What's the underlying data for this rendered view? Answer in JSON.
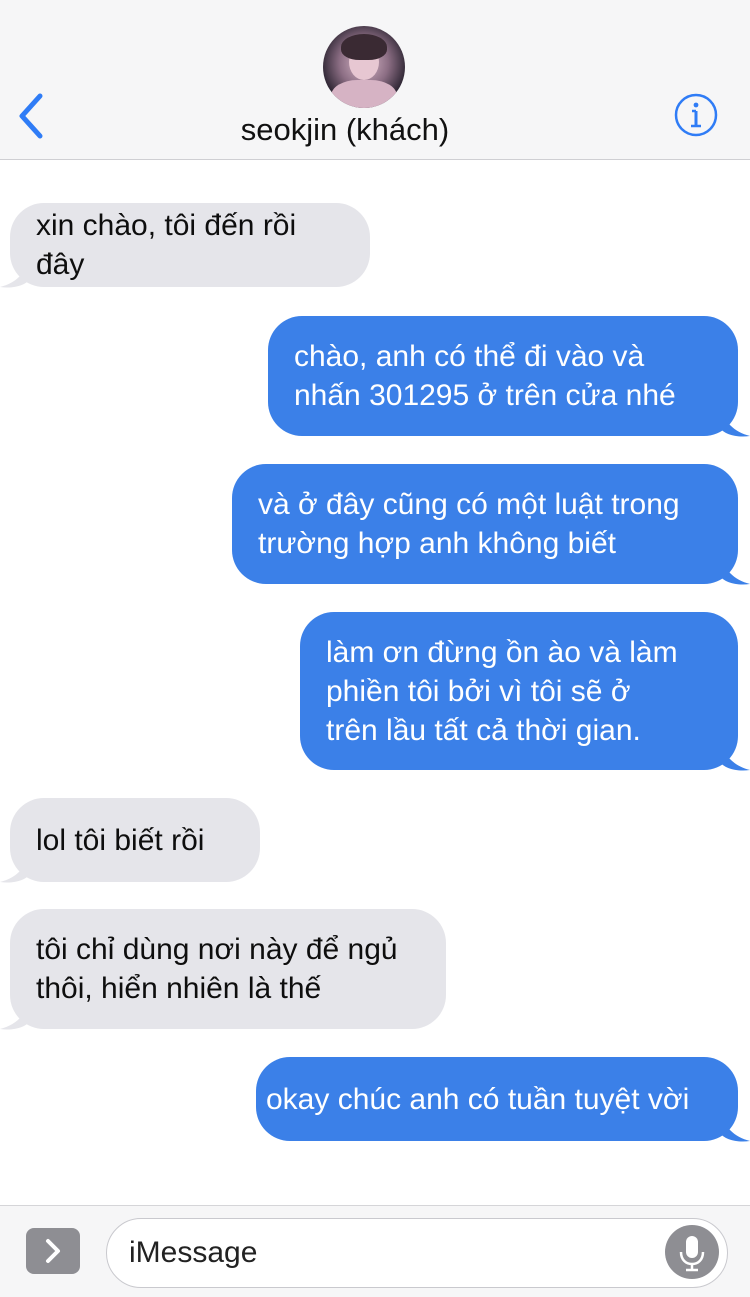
{
  "header": {
    "contact_name": "seokjin (khách)",
    "back_icon": "chevron-left-icon",
    "info_icon": "info-circle-icon",
    "accent_color": "#2f7cf6"
  },
  "messages": [
    {
      "direction": "incoming",
      "lines": [
        "xin chào, tôi đến rồi đây"
      ]
    },
    {
      "direction": "outgoing",
      "lines": [
        "chào, anh có thể đi vào và",
        "nhấn 301295 ở trên cửa nhé"
      ]
    },
    {
      "direction": "outgoing",
      "lines": [
        "và ở đây cũng có một luật trong",
        "trường hợp anh không biết"
      ]
    },
    {
      "direction": "outgoing",
      "lines": [
        "làm ơn đừng ồn ào và làm",
        "phiền tôi bởi vì tôi sẽ ở",
        "trên lầu tất cả thời gian."
      ]
    },
    {
      "direction": "incoming",
      "lines": [
        "lol tôi biết rồi"
      ]
    },
    {
      "direction": "incoming",
      "lines": [
        "tôi chỉ dùng nơi này để ngủ",
        "thôi, hiển nhiên là thế"
      ]
    },
    {
      "direction": "outgoing",
      "lines": [
        "okay chúc anh có tuần tuyệt vời"
      ]
    }
  ],
  "colors": {
    "incoming_bubble": "#e5e5ea",
    "outgoing_bubble": "#3b80e8"
  },
  "composer": {
    "placeholder": "iMessage",
    "apps_icon": "chevron-right-icon",
    "mic_icon": "microphone-icon"
  }
}
